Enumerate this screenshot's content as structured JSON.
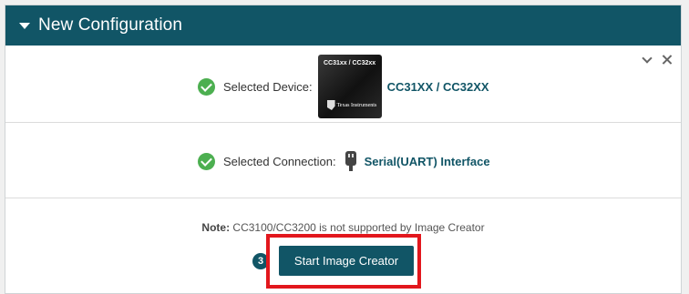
{
  "panel": {
    "title": "New Configuration"
  },
  "device": {
    "label": "Selected Device:",
    "chip_text": "CC31xx / CC32xx",
    "chip_brand": "Texas Instruments",
    "value": "CC31XX / CC32XX"
  },
  "connection": {
    "label": "Selected Connection:",
    "value": "Serial(UART) Interface"
  },
  "note": {
    "prefix": "Note:",
    "text": "CC3100/CC3200 is not supported by Image Creator"
  },
  "action": {
    "step_number": "3",
    "button_label": "Start Image Creator"
  },
  "icons": {
    "header": "caret-down-icon",
    "collapse": "chevron-down-icon",
    "close": "close-icon",
    "check": "check-circle-icon",
    "connection": "usb-plug-icon"
  },
  "colors": {
    "header_bg": "#115566",
    "accent": "#115566",
    "success": "#4caf50",
    "highlight": "#e2171d"
  }
}
